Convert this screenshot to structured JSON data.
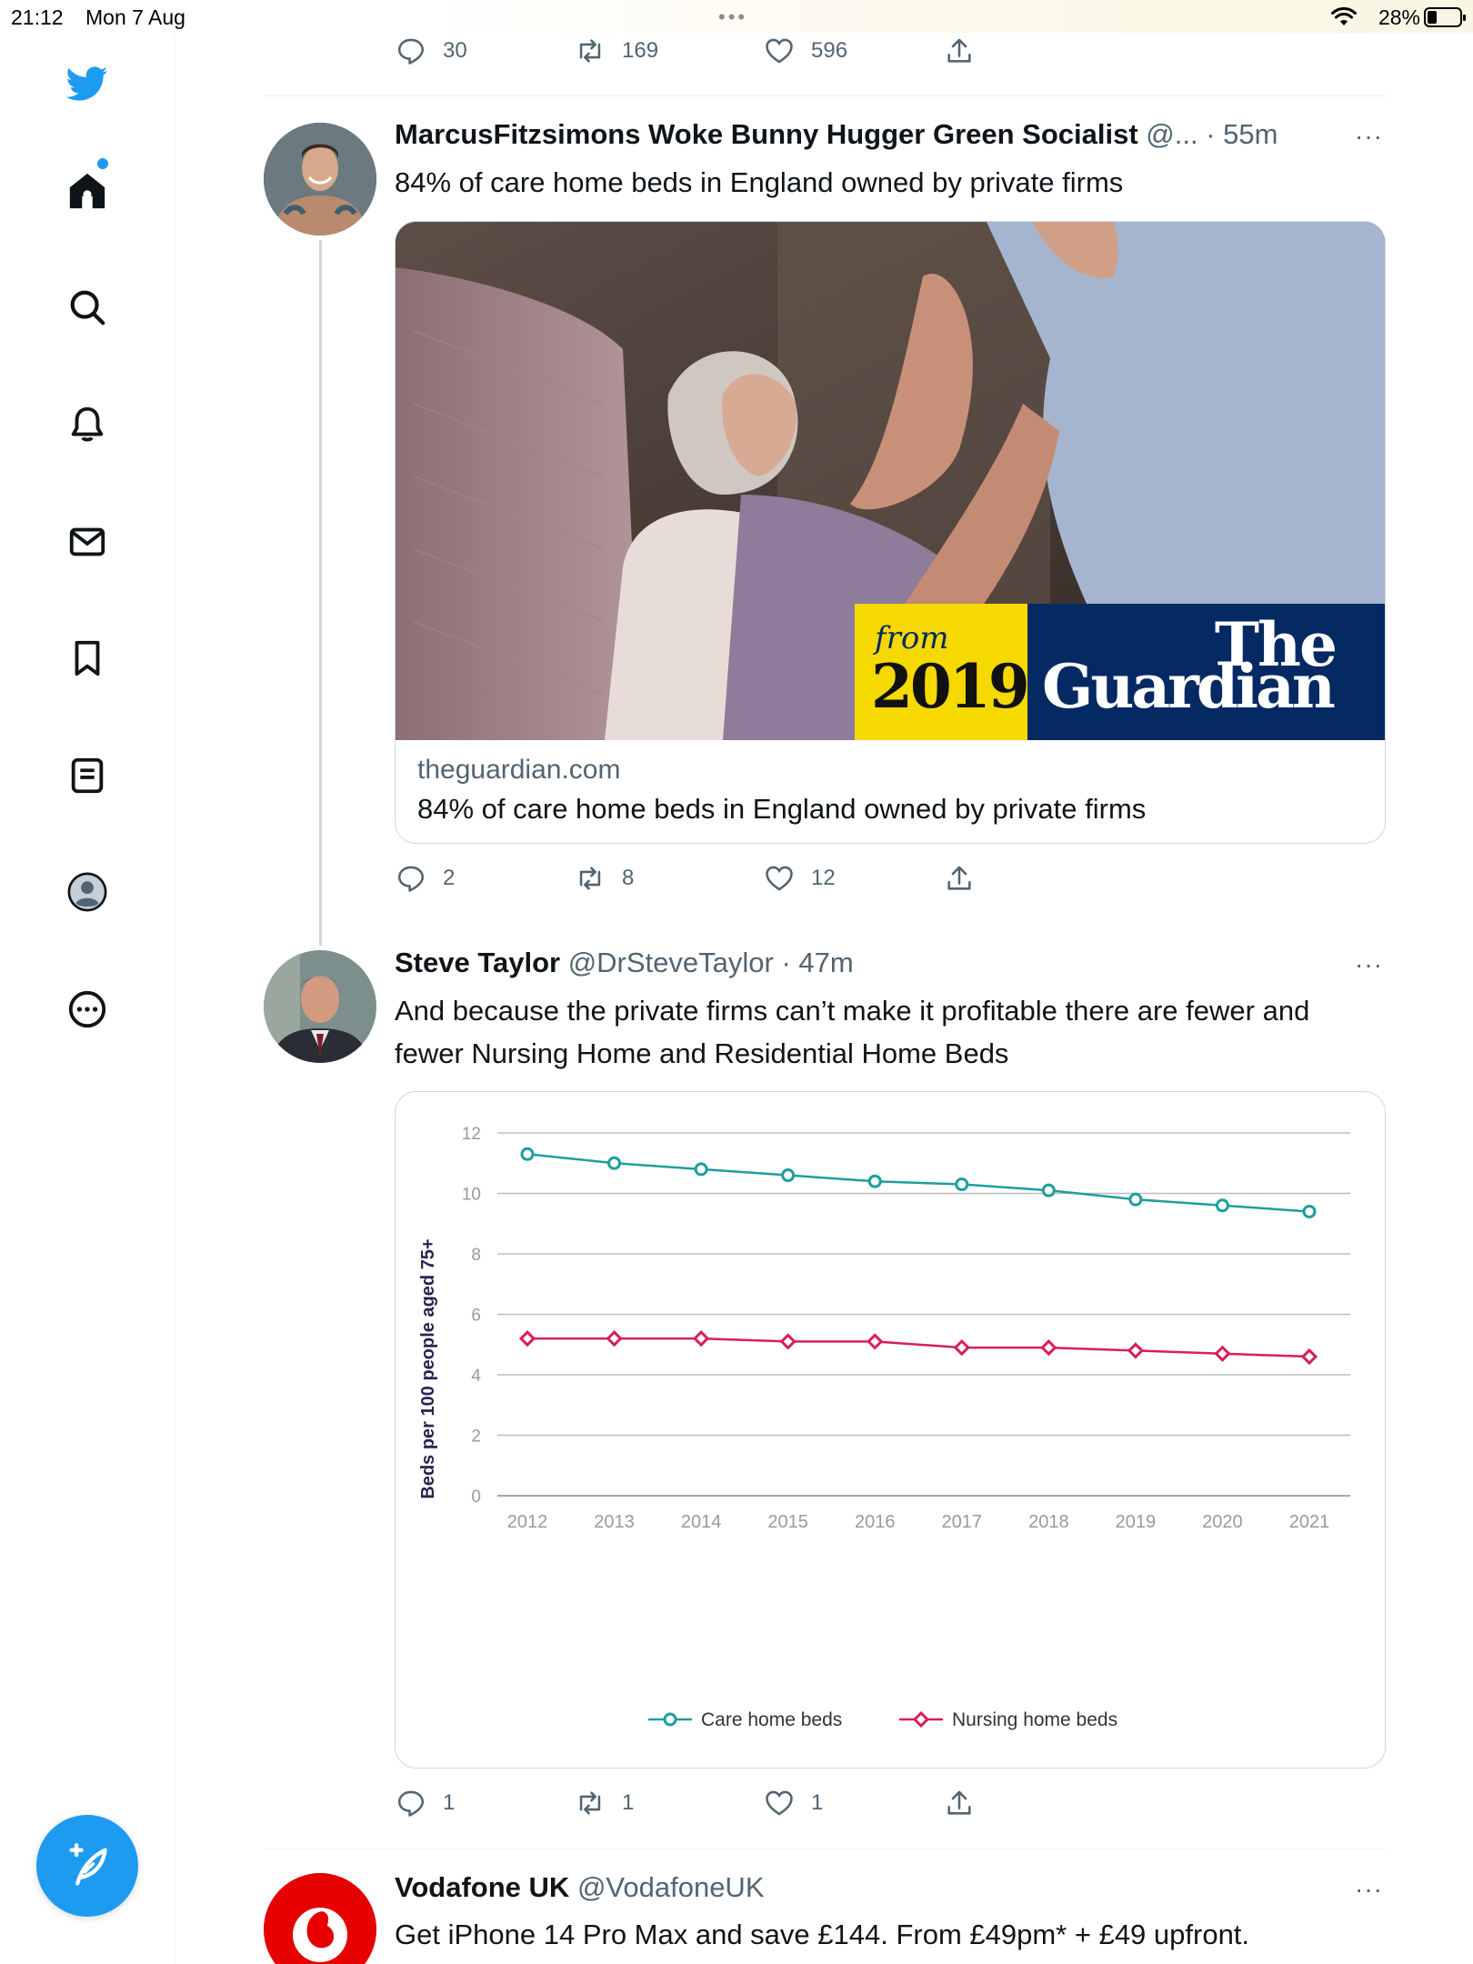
{
  "status": {
    "time": "21:12",
    "date": "Mon 7 Aug",
    "battery": "28%"
  },
  "prev_tweet": {
    "replies": "30",
    "retweets": "169",
    "likes": "596"
  },
  "tweet1": {
    "name": "MarcusFitzsimons Woke Bunny Hugger Green Socialist",
    "handle": "@...",
    "time": " · 55m",
    "text": "84% of care home beds in England owned by private firms",
    "card": {
      "badge_from": "from",
      "badge_year": "2019",
      "brand_line1": "The",
      "brand_line2": "Guardian",
      "domain": "theguardian.com",
      "title": "84% of care home beds in England owned by private firms"
    },
    "replies": "2",
    "retweets": "8",
    "likes": "12"
  },
  "tweet2": {
    "name": "Steve Taylor",
    "handle": "@DrSteveTaylor",
    "time": " · 47m",
    "text": "And because the private firms can’t make it profitable there are fewer and fewer Nursing Home and Residential Home Beds",
    "replies": "1",
    "retweets": "1",
    "likes": "1"
  },
  "tweet3": {
    "name": "Vodafone UK",
    "handle": "@VodafoneUK",
    "text": "Get iPhone 14 Pro Max and save £144. From £49pm* + £49 upfront."
  },
  "more_label": "···",
  "chart_data": {
    "type": "line",
    "title": "",
    "xlabel": "",
    "ylabel": "Beds per 100 people aged 75+",
    "ylim": [
      0,
      12
    ],
    "yticks": [
      0,
      2,
      4,
      6,
      8,
      10,
      12
    ],
    "grid": true,
    "legend_position": "bottom",
    "x": [
      "2012",
      "2013",
      "2014",
      "2015",
      "2016",
      "2017",
      "2018",
      "2019",
      "2020",
      "2021"
    ],
    "series": [
      {
        "name": "Care home beds",
        "color": "#1f9e9e",
        "marker": "circle",
        "values": [
          11.3,
          11.0,
          10.8,
          10.6,
          10.4,
          10.3,
          10.1,
          9.8,
          9.6,
          9.4
        ]
      },
      {
        "name": "Nursing home beds",
        "color": "#d81e5b",
        "marker": "diamond",
        "values": [
          5.2,
          5.2,
          5.2,
          5.1,
          5.1,
          4.9,
          4.9,
          4.8,
          4.7,
          4.6
        ]
      }
    ]
  },
  "colors": {
    "accent": "#1d9bf0",
    "text": "#0f1419",
    "secondary": "#536471",
    "border": "#cfd9de"
  },
  "icons": [
    "twitter-bird-icon",
    "home-icon",
    "search-icon",
    "bell-icon",
    "mail-icon",
    "bookmark-icon",
    "lists-icon",
    "profile-icon",
    "more-circle-icon",
    "compose-icon",
    "reply-icon",
    "retweet-icon",
    "like-icon",
    "share-icon"
  ]
}
